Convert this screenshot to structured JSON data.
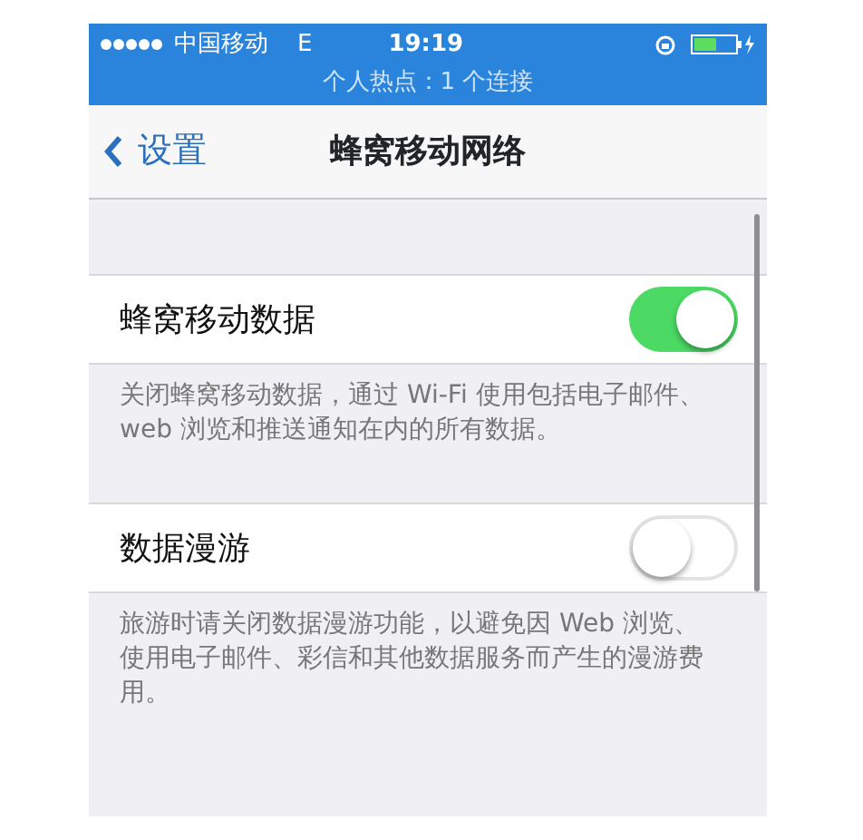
{
  "status_bar": {
    "carrier": "中国移动",
    "network": "E",
    "time": "19:19",
    "hotspot": "个人热点：1 个连接"
  },
  "nav_bar": {
    "back": "设置",
    "title": "蜂窝移动网络"
  },
  "settings": [
    {
      "label": "蜂窝移动数据",
      "on": true,
      "footer": "关闭蜂窝移动数据，通过 Wi-Fi 使用包括电子邮件、web 浏览和推送通知在内的所有数据。"
    },
    {
      "label": "数据漫游",
      "on": false,
      "footer": "旅游时请关闭数据漫游功能，以避免因 Web 浏览、使用电子邮件、彩信和其他数据服务而产生的漫游费用。"
    }
  ]
}
